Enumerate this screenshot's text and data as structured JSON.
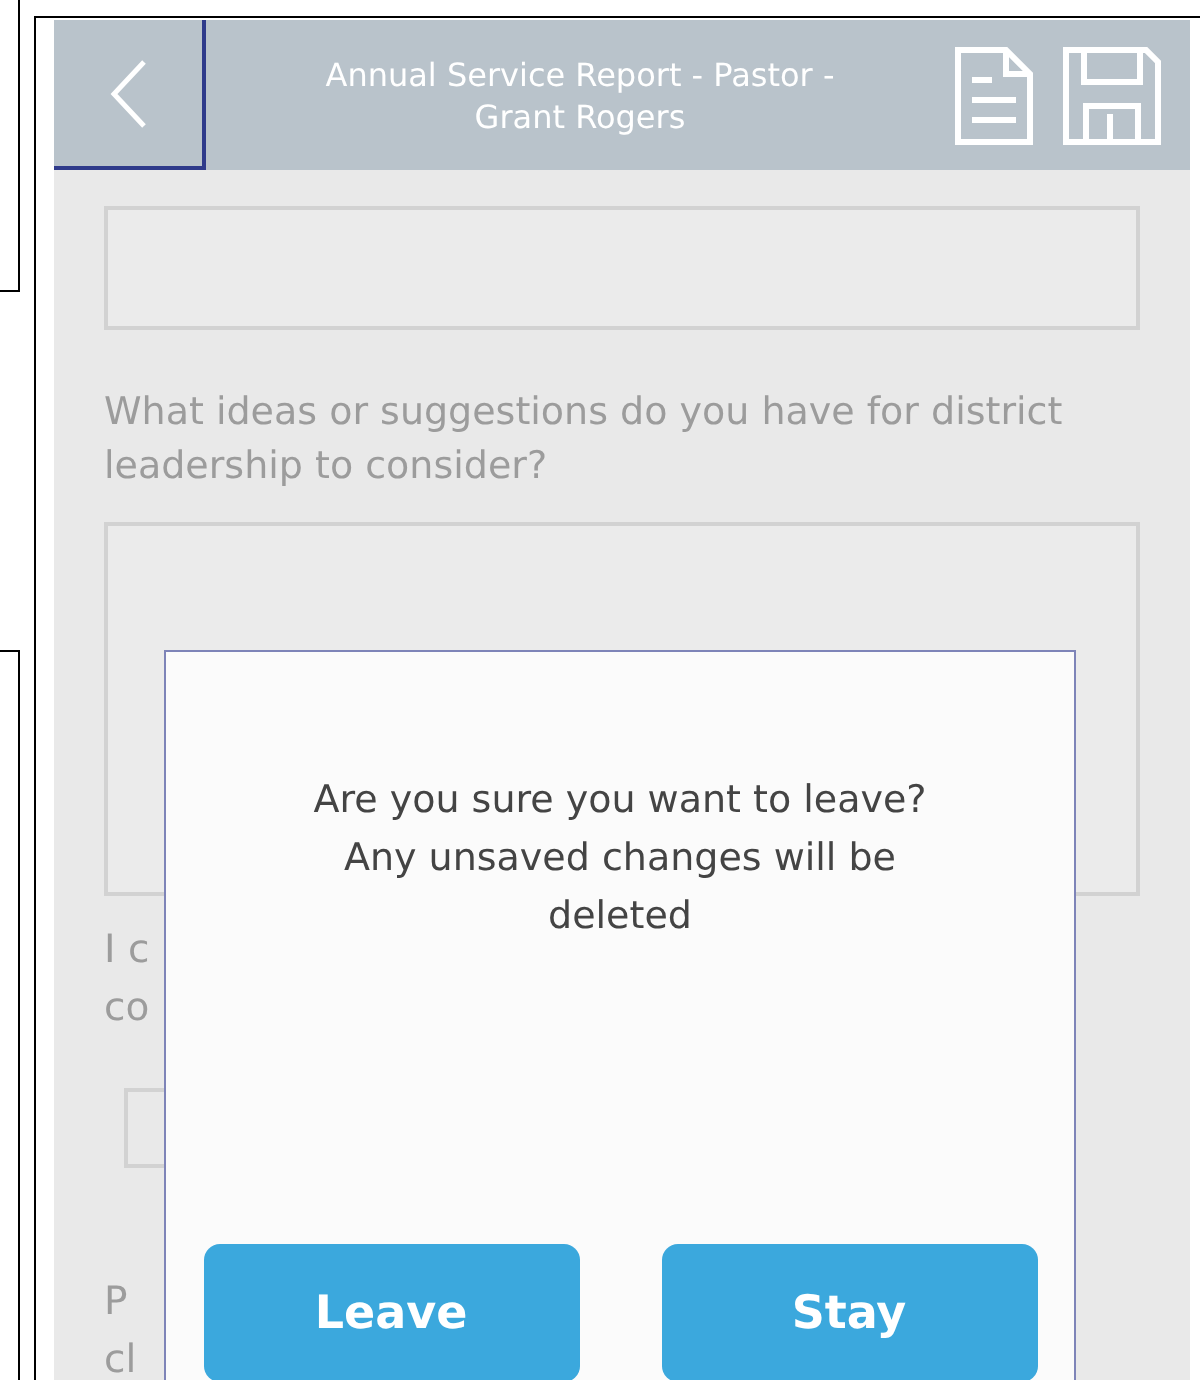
{
  "header": {
    "title": "Annual Service Report - Pastor - Grant Rogers"
  },
  "form": {
    "items": [
      {
        "kind": "textbox"
      },
      {
        "kind": "question",
        "text": "What ideas or suggestions do you have for district leadership to consider?"
      },
      {
        "kind": "textarea"
      },
      {
        "kind": "partial_label",
        "lines": [
          "I c",
          "co"
        ]
      },
      {
        "kind": "partial_field"
      },
      {
        "kind": "partial_label",
        "lines": [
          "P",
          "cl"
        ]
      }
    ]
  },
  "dialog": {
    "message": "Are you sure you want to leave? Any unsaved changes will be deleted",
    "buttons": [
      "Leave",
      "Stay"
    ]
  }
}
